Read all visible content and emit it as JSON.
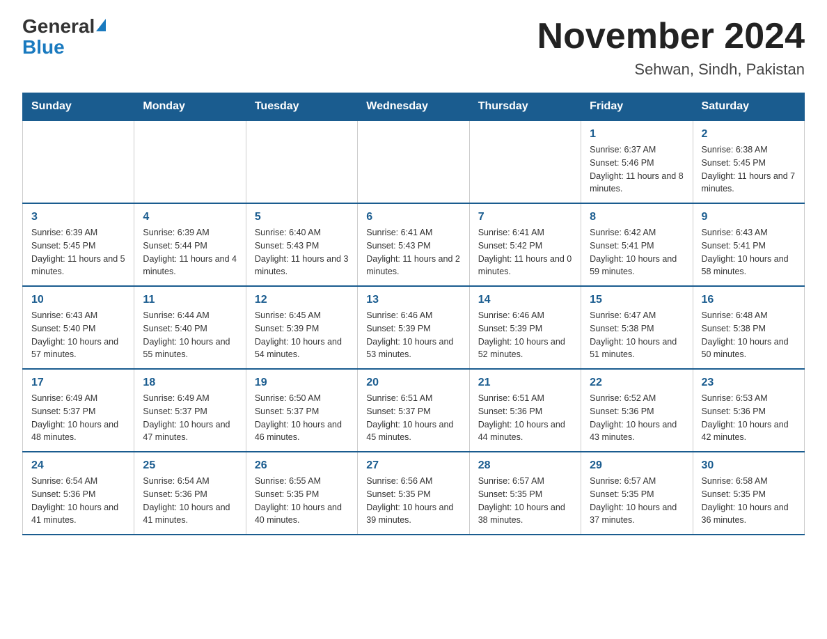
{
  "header": {
    "logo_general": "General",
    "logo_blue": "Blue",
    "month_title": "November 2024",
    "location": "Sehwan, Sindh, Pakistan"
  },
  "weekdays": [
    "Sunday",
    "Monday",
    "Tuesday",
    "Wednesday",
    "Thursday",
    "Friday",
    "Saturday"
  ],
  "weeks": [
    [
      {
        "day": "",
        "info": ""
      },
      {
        "day": "",
        "info": ""
      },
      {
        "day": "",
        "info": ""
      },
      {
        "day": "",
        "info": ""
      },
      {
        "day": "",
        "info": ""
      },
      {
        "day": "1",
        "info": "Sunrise: 6:37 AM\nSunset: 5:46 PM\nDaylight: 11 hours and 8 minutes."
      },
      {
        "day": "2",
        "info": "Sunrise: 6:38 AM\nSunset: 5:45 PM\nDaylight: 11 hours and 7 minutes."
      }
    ],
    [
      {
        "day": "3",
        "info": "Sunrise: 6:39 AM\nSunset: 5:45 PM\nDaylight: 11 hours and 5 minutes."
      },
      {
        "day": "4",
        "info": "Sunrise: 6:39 AM\nSunset: 5:44 PM\nDaylight: 11 hours and 4 minutes."
      },
      {
        "day": "5",
        "info": "Sunrise: 6:40 AM\nSunset: 5:43 PM\nDaylight: 11 hours and 3 minutes."
      },
      {
        "day": "6",
        "info": "Sunrise: 6:41 AM\nSunset: 5:43 PM\nDaylight: 11 hours and 2 minutes."
      },
      {
        "day": "7",
        "info": "Sunrise: 6:41 AM\nSunset: 5:42 PM\nDaylight: 11 hours and 0 minutes."
      },
      {
        "day": "8",
        "info": "Sunrise: 6:42 AM\nSunset: 5:41 PM\nDaylight: 10 hours and 59 minutes."
      },
      {
        "day": "9",
        "info": "Sunrise: 6:43 AM\nSunset: 5:41 PM\nDaylight: 10 hours and 58 minutes."
      }
    ],
    [
      {
        "day": "10",
        "info": "Sunrise: 6:43 AM\nSunset: 5:40 PM\nDaylight: 10 hours and 57 minutes."
      },
      {
        "day": "11",
        "info": "Sunrise: 6:44 AM\nSunset: 5:40 PM\nDaylight: 10 hours and 55 minutes."
      },
      {
        "day": "12",
        "info": "Sunrise: 6:45 AM\nSunset: 5:39 PM\nDaylight: 10 hours and 54 minutes."
      },
      {
        "day": "13",
        "info": "Sunrise: 6:46 AM\nSunset: 5:39 PM\nDaylight: 10 hours and 53 minutes."
      },
      {
        "day": "14",
        "info": "Sunrise: 6:46 AM\nSunset: 5:39 PM\nDaylight: 10 hours and 52 minutes."
      },
      {
        "day": "15",
        "info": "Sunrise: 6:47 AM\nSunset: 5:38 PM\nDaylight: 10 hours and 51 minutes."
      },
      {
        "day": "16",
        "info": "Sunrise: 6:48 AM\nSunset: 5:38 PM\nDaylight: 10 hours and 50 minutes."
      }
    ],
    [
      {
        "day": "17",
        "info": "Sunrise: 6:49 AM\nSunset: 5:37 PM\nDaylight: 10 hours and 48 minutes."
      },
      {
        "day": "18",
        "info": "Sunrise: 6:49 AM\nSunset: 5:37 PM\nDaylight: 10 hours and 47 minutes."
      },
      {
        "day": "19",
        "info": "Sunrise: 6:50 AM\nSunset: 5:37 PM\nDaylight: 10 hours and 46 minutes."
      },
      {
        "day": "20",
        "info": "Sunrise: 6:51 AM\nSunset: 5:37 PM\nDaylight: 10 hours and 45 minutes."
      },
      {
        "day": "21",
        "info": "Sunrise: 6:51 AM\nSunset: 5:36 PM\nDaylight: 10 hours and 44 minutes."
      },
      {
        "day": "22",
        "info": "Sunrise: 6:52 AM\nSunset: 5:36 PM\nDaylight: 10 hours and 43 minutes."
      },
      {
        "day": "23",
        "info": "Sunrise: 6:53 AM\nSunset: 5:36 PM\nDaylight: 10 hours and 42 minutes."
      }
    ],
    [
      {
        "day": "24",
        "info": "Sunrise: 6:54 AM\nSunset: 5:36 PM\nDaylight: 10 hours and 41 minutes."
      },
      {
        "day": "25",
        "info": "Sunrise: 6:54 AM\nSunset: 5:36 PM\nDaylight: 10 hours and 41 minutes."
      },
      {
        "day": "26",
        "info": "Sunrise: 6:55 AM\nSunset: 5:35 PM\nDaylight: 10 hours and 40 minutes."
      },
      {
        "day": "27",
        "info": "Sunrise: 6:56 AM\nSunset: 5:35 PM\nDaylight: 10 hours and 39 minutes."
      },
      {
        "day": "28",
        "info": "Sunrise: 6:57 AM\nSunset: 5:35 PM\nDaylight: 10 hours and 38 minutes."
      },
      {
        "day": "29",
        "info": "Sunrise: 6:57 AM\nSunset: 5:35 PM\nDaylight: 10 hours and 37 minutes."
      },
      {
        "day": "30",
        "info": "Sunrise: 6:58 AM\nSunset: 5:35 PM\nDaylight: 10 hours and 36 minutes."
      }
    ]
  ]
}
